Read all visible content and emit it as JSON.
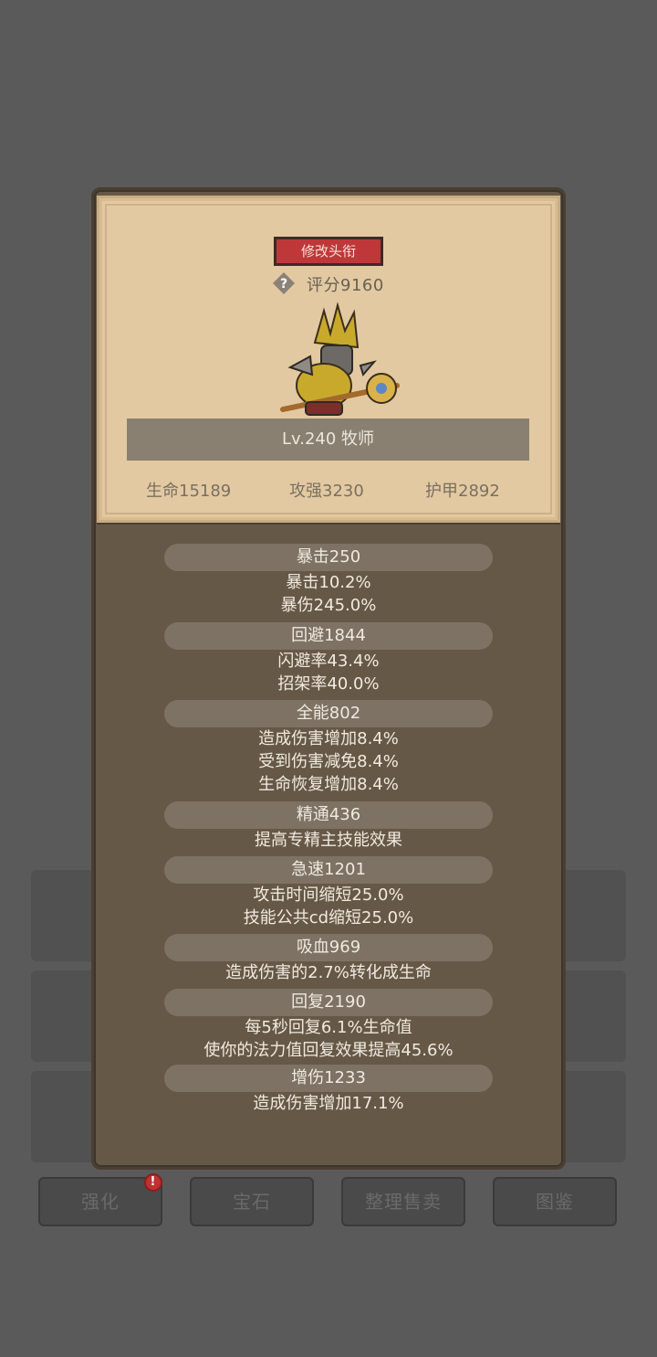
{
  "card": {
    "title_button": "修改头衔",
    "score": "评分9160",
    "level": "Lv.240 牧师",
    "stats": [
      "生命15189",
      "攻强3230",
      "护甲2892"
    ]
  },
  "groups": [
    {
      "head": "暴击250",
      "lines": [
        "暴击10.2%",
        "暴伤245.0%"
      ]
    },
    {
      "head": "回避1844",
      "lines": [
        "闪避率43.4%",
        "招架率40.0%"
      ]
    },
    {
      "head": "全能802",
      "lines": [
        "造成伤害增加8.4%",
        "受到伤害减免8.4%",
        "生命恢复增加8.4%"
      ]
    },
    {
      "head": "精通436",
      "lines": [
        "提高专精主技能效果"
      ]
    },
    {
      "head": "急速1201",
      "lines": [
        "攻击时间缩短25.0%",
        "技能公共cd缩短25.0%"
      ]
    },
    {
      "head": "吸血969",
      "lines": [
        "造成伤害的2.7%转化成生命"
      ]
    },
    {
      "head": "回复2190",
      "lines": [
        "每5秒回复6.1%生命值",
        "使你的法力值回复效果提高45.6%"
      ]
    },
    {
      "head": "增伤1233",
      "lines": [
        "造成伤害增加17.1%"
      ]
    }
  ],
  "bottom_buttons": [
    "强化",
    "宝石",
    "整理售卖",
    "图鉴"
  ],
  "colors": {
    "background": "#5a5a5a",
    "panel": "#665847",
    "card": "#e2c9a1",
    "title_button": "#c0373a",
    "alert": "#c23030"
  }
}
